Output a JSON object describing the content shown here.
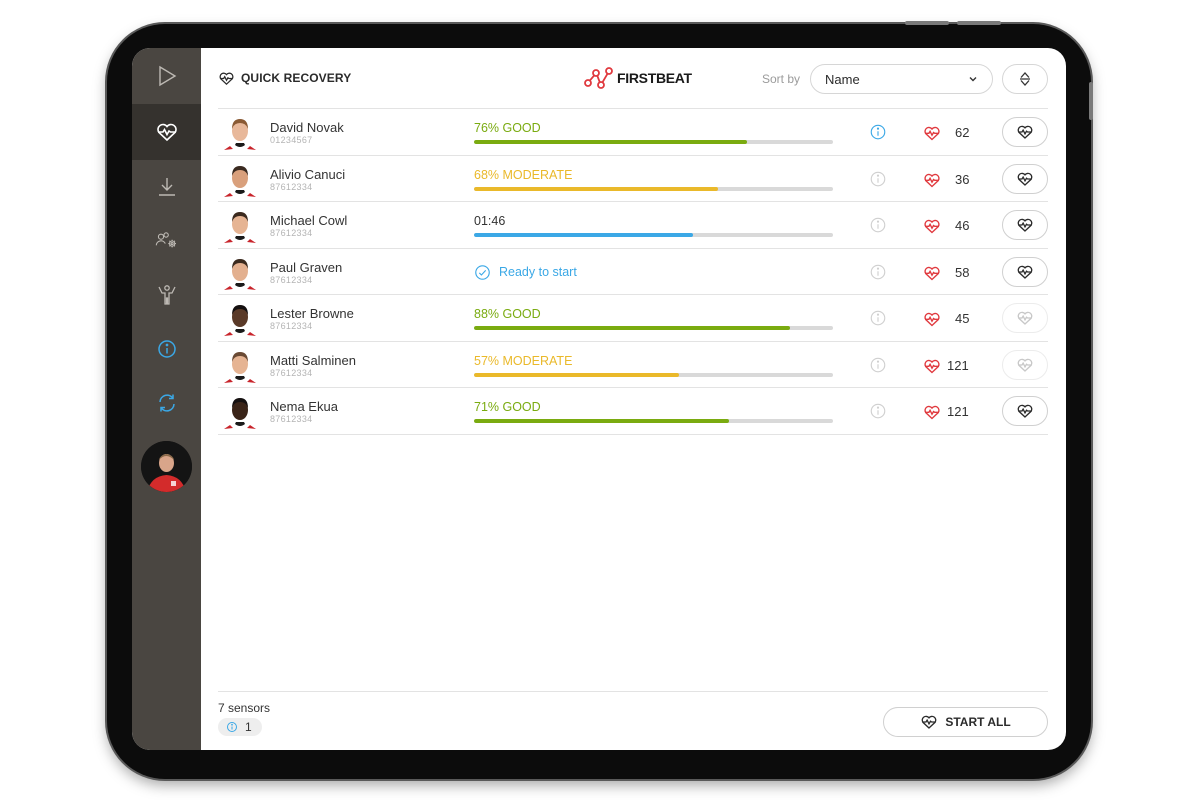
{
  "app": {
    "title": "QUICK RECOVERY",
    "brand": "FIRSTBEAT"
  },
  "colors": {
    "good": "#7aab10",
    "moderate": "#eab92a",
    "measuring": "#3ba8e6",
    "heart": "#e0393e",
    "sidebar": "#4a4641",
    "info_active": "#3ba8e6"
  },
  "sidebar": {
    "items": [
      {
        "icon": "play-icon",
        "active": false
      },
      {
        "icon": "heart-rate-icon",
        "active": true
      },
      {
        "icon": "download-icon",
        "active": false
      },
      {
        "icon": "users-settings-icon",
        "active": false
      },
      {
        "icon": "athlete-icon",
        "active": false
      },
      {
        "icon": "info-icon",
        "active": false
      },
      {
        "icon": "sync-icon",
        "active": false
      }
    ],
    "avatar": "user-avatar"
  },
  "sort": {
    "label": "Sort by",
    "selected": "Name"
  },
  "athletes": [
    {
      "name": "David Novak",
      "id": "01234567",
      "type": "score",
      "status": "76% GOOD",
      "level": "good",
      "progress": 0.76,
      "info_active": true,
      "hr": "62",
      "button_enabled": true
    },
    {
      "name": "Alivio Canuci",
      "id": "87612334",
      "type": "score",
      "status": "68% MODERATE",
      "level": "moderate",
      "progress": 0.68,
      "info_active": false,
      "hr": "36",
      "button_enabled": true
    },
    {
      "name": "Michael Cowl",
      "id": "87612334",
      "type": "timer",
      "status": "01:46",
      "level": "measuring",
      "progress": 0.61,
      "info_active": false,
      "hr": "46",
      "button_enabled": true
    },
    {
      "name": "Paul Graven",
      "id": "87612334",
      "type": "ready",
      "status": "Ready to start",
      "level": "ready",
      "progress": null,
      "info_active": false,
      "hr": "58",
      "button_enabled": true
    },
    {
      "name": "Lester Browne",
      "id": "87612334",
      "type": "score",
      "status": "88% GOOD",
      "level": "good",
      "progress": 0.88,
      "info_active": false,
      "hr": "45",
      "button_enabled": false
    },
    {
      "name": "Matti Salminen",
      "id": "87612334",
      "type": "score",
      "status": "57% MODERATE",
      "level": "moderate",
      "progress": 0.57,
      "info_active": false,
      "hr": "121",
      "button_enabled": false
    },
    {
      "name": "Nema Ekua",
      "id": "87612334",
      "type": "score",
      "status": "71% GOOD",
      "level": "good",
      "progress": 0.71,
      "info_active": false,
      "hr": "121",
      "button_enabled": true
    }
  ],
  "footer": {
    "sensor_count": "7 sensors",
    "info_count": "1",
    "start_all_label": "START ALL"
  }
}
